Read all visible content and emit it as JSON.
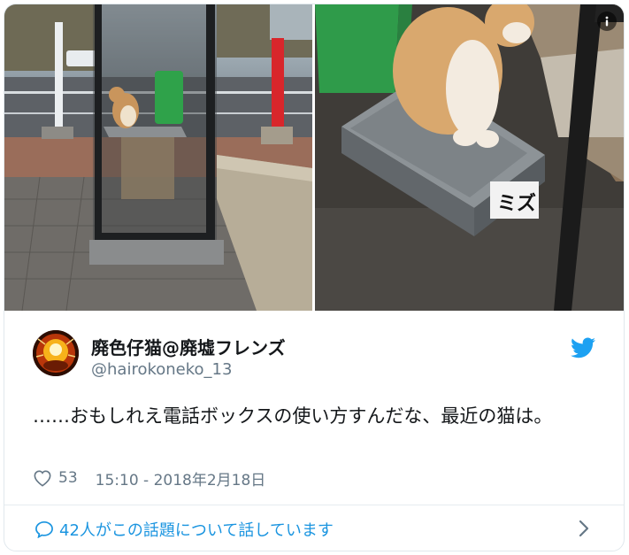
{
  "tweet": {
    "display_name": "廃色仔猫@廃墟フレンズ",
    "handle": "@hairokoneko_13",
    "text": "……おもしれえ電話ボックスの使い方すんだな、最近の猫は。",
    "like_count": "53",
    "timestamp": "15:10 - 2018年2月18日",
    "conversation_text": "42人がこの話題について話しています"
  },
  "icons": {
    "info": "info-icon",
    "bird": "twitter-bird-icon",
    "heart": "heart-icon",
    "bubble": "speech-bubble-icon",
    "chevron": "chevron-right-icon"
  },
  "colors": {
    "brand_blue": "#1da1f2",
    "link_blue": "#1b95e0",
    "secondary_text": "#657786",
    "primary_text": "#14171a",
    "border": "#e1e8ed"
  }
}
